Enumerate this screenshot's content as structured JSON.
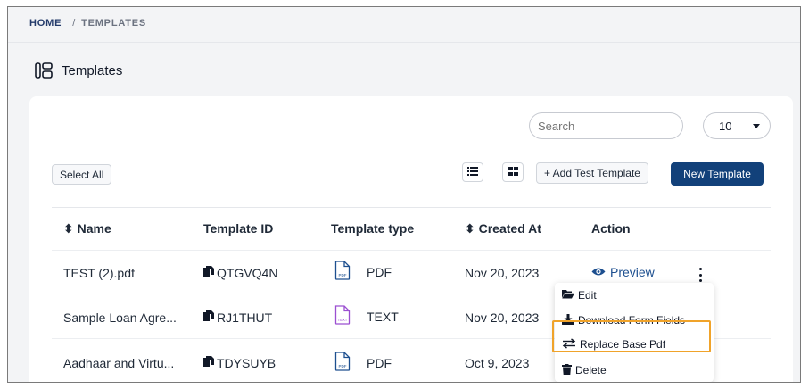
{
  "breadcrumb": {
    "home": "HOME",
    "separator": "/",
    "current": "TEMPLATES"
  },
  "page": {
    "title": "Templates",
    "icon": "layout-icon"
  },
  "toolbar": {
    "search_placeholder": "Search",
    "page_size": "10",
    "select_all": "Select All",
    "list_view_icon": "list-icon",
    "grid_view_icon": "grid-icon",
    "add_test_template": "+ Add Test Template",
    "new_template": "New Template"
  },
  "table": {
    "headers": {
      "name": "⬍ Name",
      "template_id": "Template ID",
      "template_type": "Template type",
      "created_at": "⬍ Created At",
      "action": "Action"
    },
    "rows": [
      {
        "name": "TEST (2).pdf",
        "template_id": "QTGVQ4N",
        "type": "PDF",
        "type_badge": "PDF",
        "created_at": "Nov 20, 2023"
      },
      {
        "name": "Sample Loan Agre...",
        "template_id": "RJ1THUT",
        "type": "TEXT",
        "type_badge": "TEXT",
        "created_at": "Nov 20, 2023"
      },
      {
        "name": "Aadhaar and Virtu...",
        "template_id": "TDYSUYB",
        "type": "PDF",
        "type_badge": "PDF",
        "created_at": "Oct 9, 2023"
      }
    ],
    "preview_label": "Preview"
  },
  "action_menu": {
    "items": [
      {
        "label": "Edit",
        "icon": "folder-open-icon"
      },
      {
        "label": "Download Form Fields",
        "icon": "download-icon"
      },
      {
        "label": "Replace Base Pdf",
        "icon": "swap-icon"
      },
      {
        "label": "Delete",
        "icon": "trash-icon"
      }
    ],
    "highlighted": "Replace Base Pdf"
  },
  "colors": {
    "primary": "#12417a",
    "link": "#1d4f8f",
    "highlight": "#f0a32a",
    "text_file": "#9b4fd1"
  }
}
